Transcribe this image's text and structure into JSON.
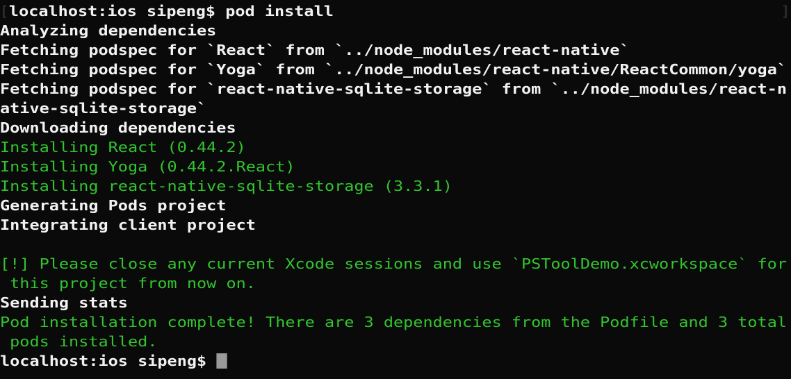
{
  "terminal": {
    "background_color": "#0a0a0a",
    "white_color": "#f2f2f2",
    "green_color": "#32c42f",
    "dim_color": "#2e2e2e",
    "cursor_color": "#9a9a9a",
    "columns": 80,
    "prompt": "localhost:ios sipeng$ ",
    "command": "pod install",
    "session_bracket_open": "[",
    "session_bracket_close": "]",
    "lines": [
      {
        "id": "line-prompt-command",
        "color": "white",
        "text": "localhost:ios sipeng$ pod install"
      },
      {
        "id": "line-analyzing",
        "color": "white",
        "text": "Analyzing dependencies"
      },
      {
        "id": "line-fetch-react",
        "color": "white",
        "text": "Fetching podspec for `React` from `../node_modules/react-native`"
      },
      {
        "id": "line-fetch-yoga",
        "color": "white",
        "text": "Fetching podspec for `Yoga` from `../node_modules/react-native/ReactCommon/yoga`"
      },
      {
        "id": "line-fetch-sqlite",
        "color": "white",
        "text": "Fetching podspec for `react-native-sqlite-storage` from `../node_modules/react-n"
      },
      {
        "id": "line-fetch-sqlite-wrap",
        "color": "white",
        "text": "ative-sqlite-storage`"
      },
      {
        "id": "line-downloading",
        "color": "white",
        "text": "Downloading dependencies"
      },
      {
        "id": "line-install-react",
        "color": "green",
        "text": "Installing React (0.44.2)"
      },
      {
        "id": "line-install-yoga",
        "color": "green",
        "text": "Installing Yoga (0.44.2.React)"
      },
      {
        "id": "line-install-sqlite",
        "color": "green",
        "text": "Installing react-native-sqlite-storage (3.3.1)"
      },
      {
        "id": "line-generating",
        "color": "white",
        "text": "Generating Pods project"
      },
      {
        "id": "line-integrating",
        "color": "white",
        "text": "Integrating client project"
      },
      {
        "id": "line-blank",
        "color": "white",
        "text": ""
      },
      {
        "id": "line-warning",
        "color": "green",
        "text": "[!] Please close any current Xcode sessions and use `PSToolDemo.xcworkspace` for"
      },
      {
        "id": "line-warning-wrap",
        "color": "green",
        "text": " this project from now on."
      },
      {
        "id": "line-sending-stats",
        "color": "white",
        "text": "Sending stats"
      },
      {
        "id": "line-complete",
        "color": "green",
        "text": "Pod installation complete! There are 3 dependencies from the Podfile and 3 total"
      },
      {
        "id": "line-complete-wrap",
        "color": "green",
        "text": " pods installed."
      }
    ],
    "final_prompt": {
      "id": "line-final-prompt",
      "color": "white",
      "text": "localhost:ios sipeng$ "
    }
  }
}
